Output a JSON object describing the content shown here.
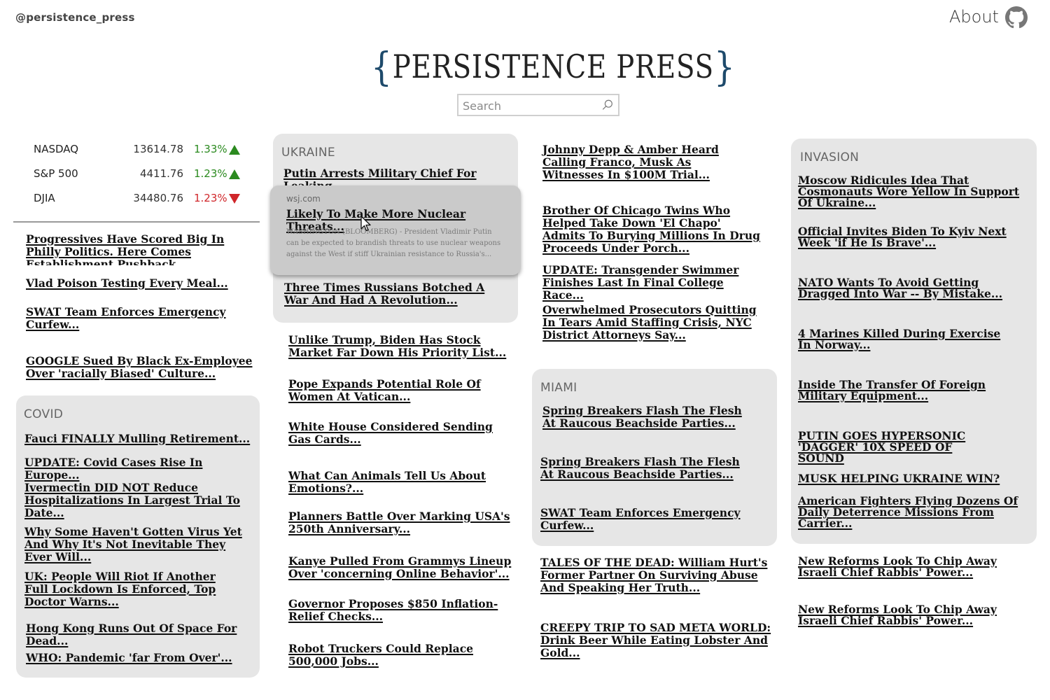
{
  "header": {
    "handle": "@persistence_press",
    "about_label": "About",
    "github_icon": "github-icon",
    "logo_open": "{",
    "logo_text": "PERSISTENCE PRESS",
    "logo_close": "}",
    "brace_color": "#1e4a6b"
  },
  "search": {
    "placeholder": "Search",
    "value": "",
    "icon": "search-icon"
  },
  "markets": [
    {
      "name": "NASDAQ",
      "value": "13614.78",
      "change": "1.33%",
      "direction": "up"
    },
    {
      "name": "S&P 500",
      "value": "4411.76",
      "change": "1.23%",
      "direction": "up"
    },
    {
      "name": "DJIA",
      "value": "34480.76",
      "change": "1.23%",
      "direction": "down"
    }
  ],
  "colors": {
    "up": "#2b8a1f",
    "down": "#d0262a",
    "panel": "#e6e6e6",
    "card": "#cacaca"
  },
  "col1": [
    "Progressives Have Scored Big In Philly Politics. Here Comes Establishment Pushback...",
    "Vlad Poison Testing Every Meal...",
    "SWAT Team Enforces Emergency Curfew...",
    "GOOGLE Sued By Black Ex-Employee Over 'racially Biased' Culture..."
  ],
  "covid": {
    "title": "COVID",
    "items": [
      "Fauci FINALLY Mulling Retirement...",
      "UPDATE: Covid Cases Rise In Europe...",
      "Ivermectin DID NOT Reduce Hospitalizations In Largest Trial To Date...",
      "Why Some Haven't Gotten Virus Yet And Why It's Not Inevitable They Ever Will...",
      "UK: People Will Riot If Another Full Lockdown Is Enforced, Top Doctor Warns...",
      "Hong Kong Runs Out Of Space For Dead...",
      "WHO: Pandemic 'far From Over'..."
    ]
  },
  "ukraine": {
    "title": "UKRAINE",
    "items": [
      "Putin Arrests Military Chief For Leaking...",
      "Three Times Russians Botched A War And Had A Revolution..."
    ],
    "card": {
      "source": "wsj.com",
      "headline": "Likely To Make More Nuclear Threats...",
      "snippet": "WASHINGTON (BLOOMBERG) - President Vladimir Putin can be expected to brandish threats to use nuclear weapons against the West if stiff Ukrainian resistance to Russia's..."
    }
  },
  "col2": [
    "Unlike Trump, Biden Has Stock Market Far Down His Priority List...",
    "Pope Expands Potential Role Of Women At Vatican...",
    "White House Considered Sending Gas Cards...",
    "What Can Animals Tell Us About Emotions?...",
    "Planners Battle Over Marking USA's 250th Anniversary...",
    "Kanye Pulled From Grammys Lineup Over 'concerning Online Behavior'...",
    "Governor Proposes $850 Inflation-Relief Checks...",
    "Robot Truckers Could Replace 500,000 Jobs..."
  ],
  "col3": [
    "Johnny Depp & Amber Heard Calling Franco, Musk As Witnesses In $100M Trial...",
    "Brother Of Chicago Twins Who Helped Take Down 'El Chapo' Admits To Burying Millions In Drug Proceeds Under Porch...",
    "UPDATE: Transgender Swimmer Finishes Last In Final College Race...",
    "Overwhelmed Prosecutors Quitting In Tears Amid Staffing Crisis, NYC District Attorneys Say..."
  ],
  "miami": {
    "title": "MIAMI",
    "items": [
      "Spring Breakers Flash The Flesh At Raucous Beachside Parties...",
      "Spring Breakers Flash The Flesh At Raucous Beachside Parties...",
      "SWAT Team Enforces Emergency Curfew..."
    ]
  },
  "col3b": [
    "TALES OF THE DEAD: William Hurt's Former Partner On Surviving Abuse And Speaking Her Truth...",
    "CREEPY TRIP TO SAD META WORLD: Drink Beer While Eating Lobster And Gold..."
  ],
  "invasion": {
    "title": "INVASION",
    "items": [
      "Moscow Ridicules Idea That Cosmonauts Wore Yellow In Support Of Ukraine...",
      "Official Invites Biden To Kyiv Next Week 'if He Is Brave'...",
      "NATO Wants To Avoid Getting Dragged Into War -- By Mistake...",
      "4 Marines Killed During Exercise In Norway...",
      "Inside The Transfer Of Foreign Military Equipment...",
      "PUTIN GOES HYPERSONIC 'DAGGER' 10X SPEED OF SOUND",
      "MUSK HELPING UKRAINE WIN?",
      "American Fighters Flying Dozens Of Daily Deterrence Missions From Carrier..."
    ]
  },
  "col4b": [
    "New Reforms Look To Chip Away Israeli Chief Rabbis' Power...",
    "New Reforms Look To Chip Away Israeli Chief Rabbis' Power..."
  ]
}
